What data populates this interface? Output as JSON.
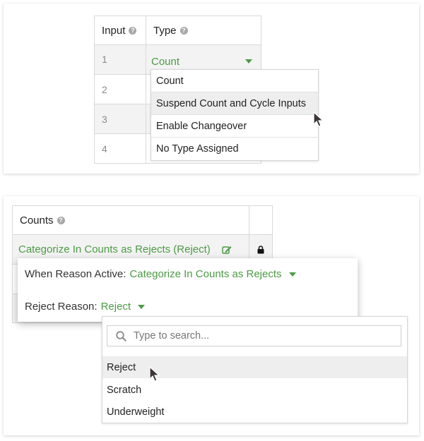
{
  "inputs_table": {
    "columns": [
      {
        "label": "Input",
        "help_icon": "question-circle-icon"
      },
      {
        "label": "Type",
        "help_icon": "question-circle-icon"
      }
    ],
    "rows": [
      {
        "input": "1",
        "type": "Count"
      },
      {
        "input": "2",
        "type": ""
      },
      {
        "input": "3",
        "type": ""
      },
      {
        "input": "4",
        "type": ""
      }
    ],
    "type_dropdown": {
      "selected": "Count",
      "options": [
        "Count",
        "Suspend Count and Cycle Inputs",
        "Enable Changeover",
        "No Type Assigned"
      ],
      "hovered": "Suspend Count and Cycle Inputs"
    }
  },
  "counts_table": {
    "header": {
      "label": "Counts",
      "help_icon": "question-circle-icon"
    },
    "row": {
      "label": "Categorize In Counts as Rejects (Reject)",
      "edit_icon": "edit-icon",
      "lock_icon": "lock-icon"
    },
    "popover": {
      "when_label": "When Reason Active:",
      "when_value": "Categorize In Counts as Rejects",
      "reason_label": "Reject Reason:",
      "reason_value": "Reject"
    },
    "reason_dropdown": {
      "search_placeholder": "Type to search...",
      "options": [
        "Reject",
        "Scratch",
        "Underweight"
      ],
      "hovered": "Reject"
    }
  },
  "colors": {
    "accent_green": "#4c9a45",
    "row_shade": "#f3f3f3",
    "hover": "#eeeeee",
    "border": "#d9d9d9"
  }
}
